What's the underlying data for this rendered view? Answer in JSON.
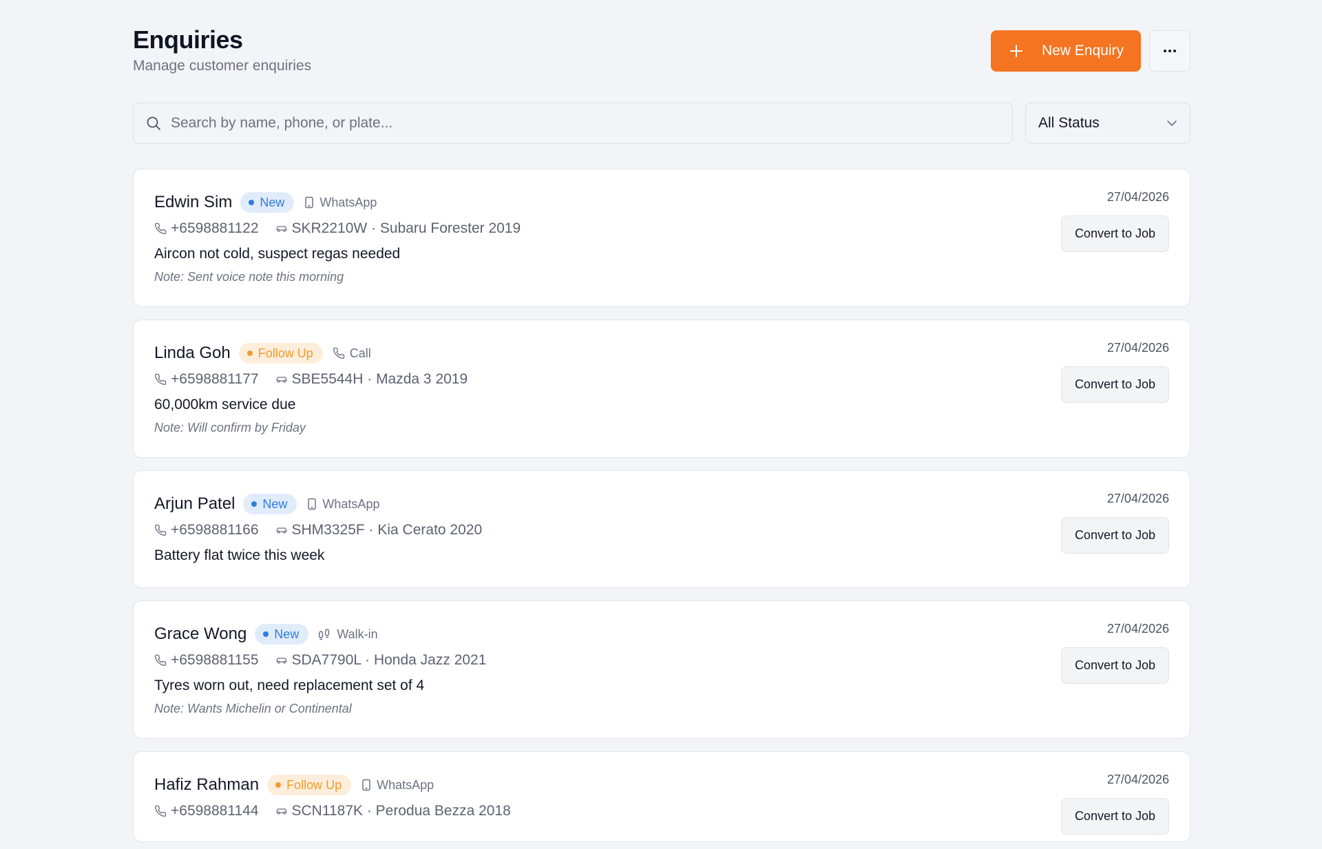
{
  "header": {
    "title": "Enquiries",
    "subtitle": "Manage customer enquiries",
    "new_button_label": "New Enquiry"
  },
  "search": {
    "placeholder": "Search by name, phone, or plate..."
  },
  "status_filter": {
    "selected": "All Status"
  },
  "convert_label": "Convert to Job",
  "enquiries": [
    {
      "name": "Edwin Sim",
      "status": "New",
      "channel": "WhatsApp",
      "phone": "+6598881122",
      "vehicle": "SKR2210W · Subaru Forester 2019",
      "description": "Aircon not cold, suspect regas needed",
      "note": "Note: Sent voice note this morning",
      "date": "27/04/2026"
    },
    {
      "name": "Linda Goh",
      "status": "Follow Up",
      "channel": "Call",
      "phone": "+6598881177",
      "vehicle": "SBE5544H · Mazda 3 2019",
      "description": "60,000km service due",
      "note": "Note: Will confirm by Friday",
      "date": "27/04/2026"
    },
    {
      "name": "Arjun Patel",
      "status": "New",
      "channel": "WhatsApp",
      "phone": "+6598881166",
      "vehicle": "SHM3325F · Kia Cerato 2020",
      "description": "Battery flat twice this week",
      "note": "",
      "date": "27/04/2026"
    },
    {
      "name": "Grace Wong",
      "status": "New",
      "channel": "Walk-in",
      "phone": "+6598881155",
      "vehicle": "SDA7790L · Honda Jazz 2021",
      "description": "Tyres worn out, need replacement set of 4",
      "note": "Note: Wants Michelin or Continental",
      "date": "27/04/2026"
    },
    {
      "name": "Hafiz Rahman",
      "status": "Follow Up",
      "channel": "WhatsApp",
      "phone": "+6598881144",
      "vehicle": "SCN1187K · Perodua Bezza 2018",
      "description": "",
      "note": "",
      "date": "27/04/2026"
    }
  ]
}
